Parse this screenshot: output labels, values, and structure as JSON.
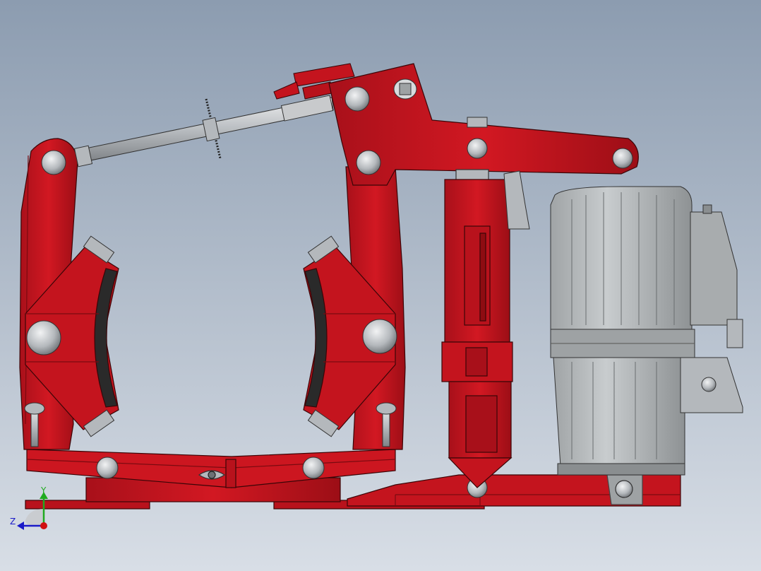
{
  "triad": {
    "y_label": "Y",
    "z_label": "Z"
  },
  "colors": {
    "background_top": "#8C9CB0",
    "background_bottom": "#D8DEE6",
    "brake_red": "#C8141E",
    "brake_red_dark": "#8E0C12",
    "brake_edge": "#3A0507",
    "steel_light": "#D4D6D8",
    "steel_mid": "#A8ACB0",
    "steel_dark": "#5A5E62",
    "lining_dark": "#2A2A2A",
    "motor_gray": "#B6BABC",
    "motor_gray_dark": "#8A8E90",
    "axis_y": "#1FAA1F",
    "axis_z": "#1A1AC8",
    "axis_x_dot": "#D01010"
  }
}
